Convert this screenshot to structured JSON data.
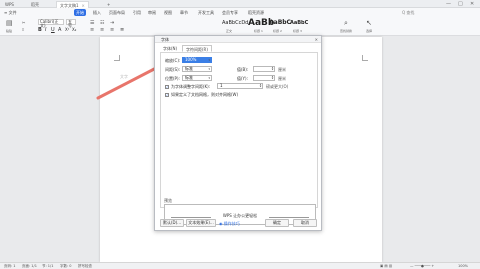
{
  "titlebar": {
    "tabs": [
      {
        "label": "WPS",
        "active": false
      },
      {
        "label": "稻壳",
        "active": false
      },
      {
        "label": "文字文稿1",
        "active": true
      }
    ],
    "add_tab": "+",
    "minimize": "—",
    "restore": "□",
    "close": "✕"
  },
  "menubar": {
    "file": "≡ 文件",
    "items": [
      "开始",
      "插入",
      "页面布局",
      "引用",
      "审阅",
      "视图",
      "章节",
      "开发工具",
      "会员专享",
      "稻壳资源"
    ],
    "active_index": 0,
    "search": "Q 查找"
  },
  "ribbon": {
    "paste": "粘贴",
    "font_name": "Calibri(正文)",
    "font_size": "五号",
    "format_buttons": [
      "B",
      "I",
      "U",
      "A",
      "X²",
      "X₂"
    ],
    "styles": [
      {
        "text": "AaBbCcDd",
        "name": "正文"
      },
      {
        "text": "AaBb",
        "name": "标题 1"
      },
      {
        "text": "AaBbC",
        "name": "标题 2"
      },
      {
        "text": "AaBbC",
        "name": "标题 3"
      }
    ],
    "tools": [
      {
        "icon": "search-icon",
        "label": "查找替换"
      },
      {
        "icon": "cursor-icon",
        "label": "选择"
      }
    ]
  },
  "document": {
    "text": "文字"
  },
  "dialog": {
    "title": "字体",
    "close": "✕",
    "tabs": [
      "字体(N)",
      "字符间距(R)"
    ],
    "active_tab": 1,
    "scale_label": "缩放(C):",
    "scale_value": "100%",
    "spacing_label": "间距(S):",
    "spacing_value": "标准",
    "spacing_by_label": "值(B):",
    "spacing_by_unit": "厘米",
    "position_label": "位置(P):",
    "position_value": "标准",
    "position_by_label": "值(Y):",
    "position_by_unit": "厘米",
    "kerning_label": "为字体调整字间距(K):",
    "kerning_value": "1",
    "kerning_unit": "磅或更大(O)",
    "snap_grid_label": "如果定义了文档网格，则对齐网格(W)",
    "preview_label": "预览",
    "preview_text": "WPS 让办公更轻松",
    "default_button": "默认(D)...",
    "text_effects_button": "文本效果(E)...",
    "tips_link": "操作技巧",
    "ok_button": "确定",
    "cancel_button": "取消"
  },
  "statusbar": {
    "page": "页码: 1",
    "pages": "页面: 1/1",
    "section": "节: 1/1",
    "words": "字数: 0",
    "spell": "拼写检查",
    "zoom": "100%"
  },
  "colors": {
    "accent": "#2f6fe4",
    "arrow": "#e8756b"
  }
}
